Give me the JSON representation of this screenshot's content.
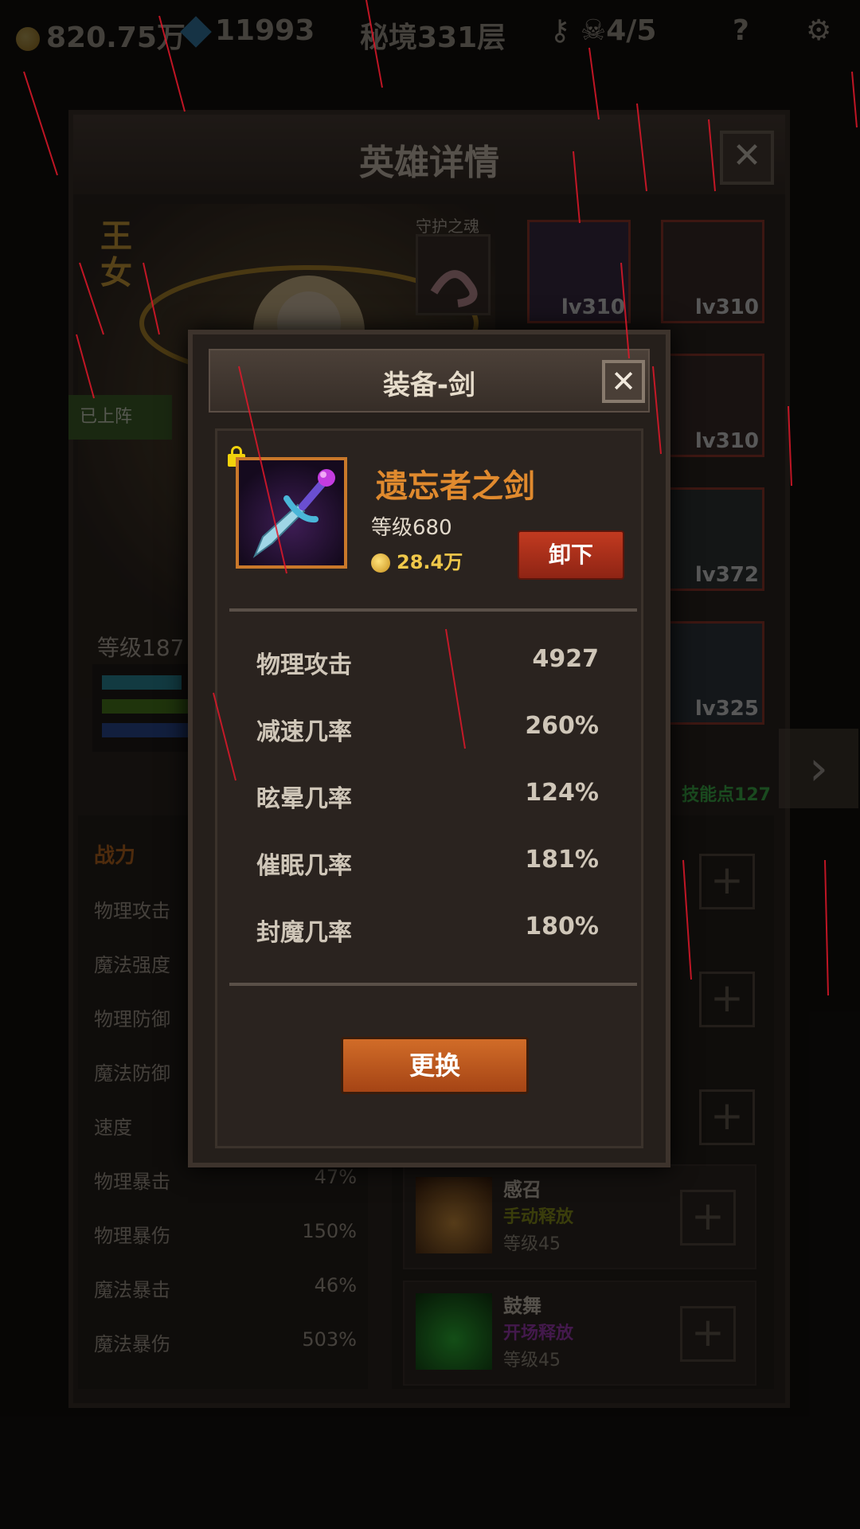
{
  "hud": {
    "gold": "820.75万",
    "gems": "11993",
    "floor": "秘境331层",
    "keys": "4/5",
    "help": "?"
  },
  "hero_panel": {
    "title": "英雄详情",
    "close": "✕",
    "hero_name": "王女",
    "deploy_status": "已上阵",
    "guard_label": "守护之魂",
    "level": "等级187",
    "equipment": [
      {
        "level": "lv310"
      },
      {
        "level": "lv310"
      },
      {
        "level": "lv310"
      },
      {
        "level": "lv372"
      },
      {
        "level": "lv325"
      }
    ],
    "skill_points": "技能点127",
    "stats_header": "战力",
    "stats": [
      {
        "label": "物理攻击",
        "value": ""
      },
      {
        "label": "魔法强度",
        "value": ""
      },
      {
        "label": "物理防御",
        "value": ""
      },
      {
        "label": "魔法防御",
        "value": ""
      },
      {
        "label": "速度",
        "value": ""
      },
      {
        "label": "物理暴击",
        "value": "47%"
      },
      {
        "label": "物理暴伤",
        "value": "150%"
      },
      {
        "label": "魔法暴击",
        "value": "46%"
      },
      {
        "label": "魔法暴伤",
        "value": "503%"
      }
    ],
    "skills": [
      {
        "name": "感召",
        "type": "手动释放",
        "level": "等级45"
      },
      {
        "name": "鼓舞",
        "type": "开场释放",
        "level": "等级45"
      }
    ]
  },
  "modal": {
    "title": "装备-剑",
    "close": "✕",
    "item_name": "遗忘者之剑",
    "item_level": "等级680",
    "price": "28.4万",
    "unequip": "卸下",
    "attributes": [
      {
        "label": "物理攻击",
        "value": "4927"
      },
      {
        "label": "减速几率",
        "value": "260%"
      },
      {
        "label": "眩晕几率",
        "value": "124%"
      },
      {
        "label": "催眠几率",
        "value": "181%"
      },
      {
        "label": "封魔几率",
        "value": "180%"
      }
    ],
    "replace": "更换"
  },
  "colors": {
    "item_name": "#e08a2e",
    "unequip_button": "#c23a20",
    "replace_button": "#d16c28",
    "frame_border": "#c9782a",
    "rain": "#e0182a"
  }
}
